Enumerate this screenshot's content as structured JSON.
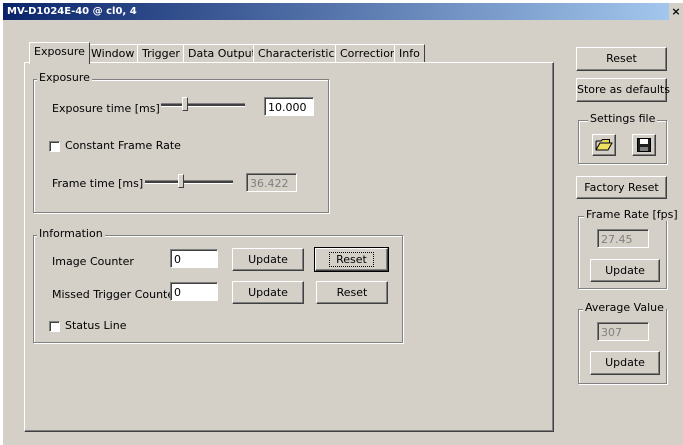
{
  "window": {
    "title": "MV-D1024E-40 @ cl0, 4",
    "close_glyph": "×"
  },
  "tabs": [
    "Exposure",
    "Window",
    "Trigger",
    "Data Output",
    "Characteristics",
    "Correction",
    "Info"
  ],
  "exposure": {
    "group_label": "Exposure",
    "exposure_time_label": "Exposure time [ms]",
    "exposure_time_value": "10.000",
    "constant_frame_rate_label": "Constant Frame Rate",
    "frame_time_label": "Frame time [ms]",
    "frame_time_value": "36.422"
  },
  "information": {
    "group_label": "Information",
    "image_counter_label": "Image Counter",
    "image_counter_value": "0",
    "update_label": "Update",
    "reset_label": "Reset",
    "missed_trigger_label": "Missed Trigger Counter",
    "missed_trigger_value": "0",
    "status_line_label": "Status Line"
  },
  "side": {
    "reset_label": "Reset",
    "store_defaults_label": "Store as defaults",
    "settings_file_label": "Settings file",
    "open_icon": "folder-open-icon",
    "save_icon": "floppy-disk-icon",
    "factory_reset_label": "Factory Reset",
    "frame_rate_label": "Frame Rate [fps]",
    "frame_rate_value": "27.45",
    "frame_rate_update_label": "Update",
    "average_value_label": "Average Value",
    "average_value_value": "307",
    "average_update_label": "Update"
  }
}
